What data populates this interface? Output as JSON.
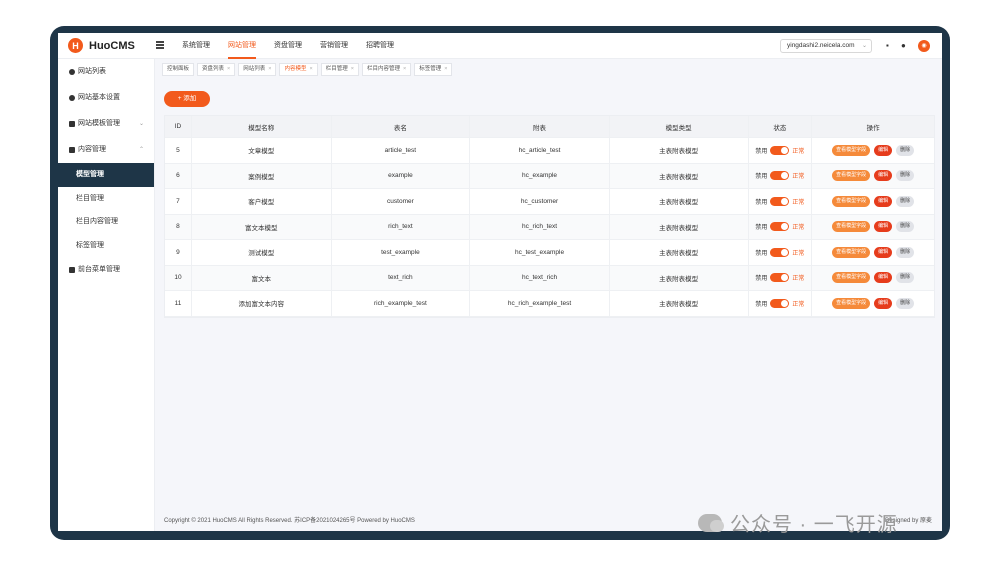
{
  "header": {
    "logo_mark": "H",
    "brand": "HuoCMS",
    "nav": [
      "系统管理",
      "网站管理",
      "资盘管理",
      "营销管理",
      "招聘管理"
    ],
    "active_nav": 1,
    "site": "yingdashi2.neicela.com",
    "icons": [
      "message-icon",
      "bell-icon",
      "user-avatar-icon"
    ]
  },
  "sidebar": {
    "items": [
      {
        "label": "网站列表",
        "icon": "globe-icon"
      },
      {
        "label": "网站基本设置",
        "icon": "settings-icon"
      },
      {
        "label": "网站模板管理",
        "icon": "template-icon",
        "chevron": "⌄"
      },
      {
        "label": "内容管理",
        "icon": "content-icon",
        "chevron": "⌃"
      }
    ],
    "sub_items": [
      "模型管理",
      "栏目管理",
      "栏目内容管理",
      "标签管理"
    ],
    "active_sub": 0,
    "bottom_item": {
      "label": "前台菜单管理",
      "icon": "grid-icon"
    }
  },
  "tabs": [
    {
      "label": "控制面板",
      "close": ""
    },
    {
      "label": "资盘列表",
      "close": "×"
    },
    {
      "label": "网站列表",
      "close": "×"
    },
    {
      "label": "内容模型",
      "close": "×",
      "active": true
    },
    {
      "label": "栏目管理",
      "close": "×"
    },
    {
      "label": "栏目内容管理",
      "close": "×"
    },
    {
      "label": "标签管理",
      "close": "×"
    }
  ],
  "add_button": "+ 添加",
  "table": {
    "headers": [
      "ID",
      "模型名称",
      "表名",
      "附表",
      "模型类型",
      "状态",
      "操作"
    ],
    "rows": [
      {
        "id": "5",
        "name": "文章模型",
        "table": "article_test",
        "sub": "hc_article_test",
        "type": "主表附表模型"
      },
      {
        "id": "6",
        "name": "案例模型",
        "table": "example",
        "sub": "hc_example",
        "type": "主表附表模型"
      },
      {
        "id": "7",
        "name": "客户模型",
        "table": "customer",
        "sub": "hc_customer",
        "type": "主表附表模型"
      },
      {
        "id": "8",
        "name": "富文本模型",
        "table": "rich_text",
        "sub": "hc_rich_text",
        "type": "主表附表模型"
      },
      {
        "id": "9",
        "name": "测试模型",
        "table": "test_example",
        "sub": "hc_test_example",
        "type": "主表附表模型"
      },
      {
        "id": "10",
        "name": "富文本",
        "table": "text_rich",
        "sub": "hc_text_rich",
        "type": "主表附表模型"
      },
      {
        "id": "11",
        "name": "添加富文本内容",
        "table": "rich_example_test",
        "sub": "hc_rich_example_test",
        "type": "主表附表模型"
      }
    ],
    "status_off": "禁用",
    "status_on": "正常",
    "op_view": "查看模型字段",
    "op_edit": "编辑",
    "op_delete": "删除"
  },
  "footer": {
    "copyright": "Copyright © 2021 HuoCMS All Rights Reserved. 苏ICP备2021024265号 Powered by HuoCMS",
    "designed": "Designed by 原麦"
  },
  "watermark": "公众号 · 一飞开源",
  "colors": {
    "accent": "#f25a1c",
    "frame": "#1e3547",
    "sidebar_active": "#1e3547"
  }
}
